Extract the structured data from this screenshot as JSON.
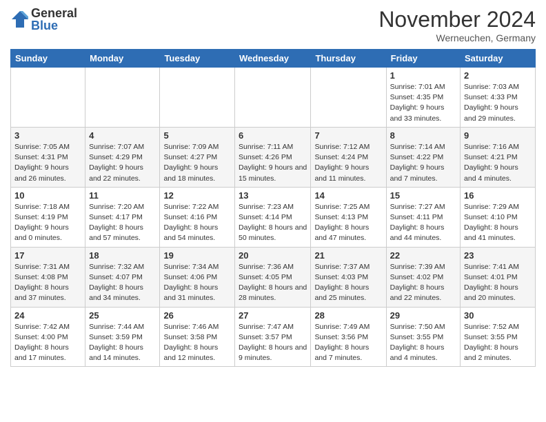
{
  "logo": {
    "general": "General",
    "blue": "Blue"
  },
  "title": "November 2024",
  "location": "Werneuchen, Germany",
  "days_of_week": [
    "Sunday",
    "Monday",
    "Tuesday",
    "Wednesday",
    "Thursday",
    "Friday",
    "Saturday"
  ],
  "weeks": [
    [
      null,
      null,
      null,
      null,
      null,
      {
        "day": "1",
        "sunrise": "7:01 AM",
        "sunset": "4:35 PM",
        "daylight": "9 hours and 33 minutes."
      },
      {
        "day": "2",
        "sunrise": "7:03 AM",
        "sunset": "4:33 PM",
        "daylight": "9 hours and 29 minutes."
      }
    ],
    [
      {
        "day": "3",
        "sunrise": "7:05 AM",
        "sunset": "4:31 PM",
        "daylight": "9 hours and 26 minutes."
      },
      {
        "day": "4",
        "sunrise": "7:07 AM",
        "sunset": "4:29 PM",
        "daylight": "9 hours and 22 minutes."
      },
      {
        "day": "5",
        "sunrise": "7:09 AM",
        "sunset": "4:27 PM",
        "daylight": "9 hours and 18 minutes."
      },
      {
        "day": "6",
        "sunrise": "7:11 AM",
        "sunset": "4:26 PM",
        "daylight": "9 hours and 15 minutes."
      },
      {
        "day": "7",
        "sunrise": "7:12 AM",
        "sunset": "4:24 PM",
        "daylight": "9 hours and 11 minutes."
      },
      {
        "day": "8",
        "sunrise": "7:14 AM",
        "sunset": "4:22 PM",
        "daylight": "9 hours and 7 minutes."
      },
      {
        "day": "9",
        "sunrise": "7:16 AM",
        "sunset": "4:21 PM",
        "daylight": "9 hours and 4 minutes."
      }
    ],
    [
      {
        "day": "10",
        "sunrise": "7:18 AM",
        "sunset": "4:19 PM",
        "daylight": "9 hours and 0 minutes."
      },
      {
        "day": "11",
        "sunrise": "7:20 AM",
        "sunset": "4:17 PM",
        "daylight": "8 hours and 57 minutes."
      },
      {
        "day": "12",
        "sunrise": "7:22 AM",
        "sunset": "4:16 PM",
        "daylight": "8 hours and 54 minutes."
      },
      {
        "day": "13",
        "sunrise": "7:23 AM",
        "sunset": "4:14 PM",
        "daylight": "8 hours and 50 minutes."
      },
      {
        "day": "14",
        "sunrise": "7:25 AM",
        "sunset": "4:13 PM",
        "daylight": "8 hours and 47 minutes."
      },
      {
        "day": "15",
        "sunrise": "7:27 AM",
        "sunset": "4:11 PM",
        "daylight": "8 hours and 44 minutes."
      },
      {
        "day": "16",
        "sunrise": "7:29 AM",
        "sunset": "4:10 PM",
        "daylight": "8 hours and 41 minutes."
      }
    ],
    [
      {
        "day": "17",
        "sunrise": "7:31 AM",
        "sunset": "4:08 PM",
        "daylight": "8 hours and 37 minutes."
      },
      {
        "day": "18",
        "sunrise": "7:32 AM",
        "sunset": "4:07 PM",
        "daylight": "8 hours and 34 minutes."
      },
      {
        "day": "19",
        "sunrise": "7:34 AM",
        "sunset": "4:06 PM",
        "daylight": "8 hours and 31 minutes."
      },
      {
        "day": "20",
        "sunrise": "7:36 AM",
        "sunset": "4:05 PM",
        "daylight": "8 hours and 28 minutes."
      },
      {
        "day": "21",
        "sunrise": "7:37 AM",
        "sunset": "4:03 PM",
        "daylight": "8 hours and 25 minutes."
      },
      {
        "day": "22",
        "sunrise": "7:39 AM",
        "sunset": "4:02 PM",
        "daylight": "8 hours and 22 minutes."
      },
      {
        "day": "23",
        "sunrise": "7:41 AM",
        "sunset": "4:01 PM",
        "daylight": "8 hours and 20 minutes."
      }
    ],
    [
      {
        "day": "24",
        "sunrise": "7:42 AM",
        "sunset": "4:00 PM",
        "daylight": "8 hours and 17 minutes."
      },
      {
        "day": "25",
        "sunrise": "7:44 AM",
        "sunset": "3:59 PM",
        "daylight": "8 hours and 14 minutes."
      },
      {
        "day": "26",
        "sunrise": "7:46 AM",
        "sunset": "3:58 PM",
        "daylight": "8 hours and 12 minutes."
      },
      {
        "day": "27",
        "sunrise": "7:47 AM",
        "sunset": "3:57 PM",
        "daylight": "8 hours and 9 minutes."
      },
      {
        "day": "28",
        "sunrise": "7:49 AM",
        "sunset": "3:56 PM",
        "daylight": "8 hours and 7 minutes."
      },
      {
        "day": "29",
        "sunrise": "7:50 AM",
        "sunset": "3:55 PM",
        "daylight": "8 hours and 4 minutes."
      },
      {
        "day": "30",
        "sunrise": "7:52 AM",
        "sunset": "3:55 PM",
        "daylight": "8 hours and 2 minutes."
      }
    ]
  ]
}
